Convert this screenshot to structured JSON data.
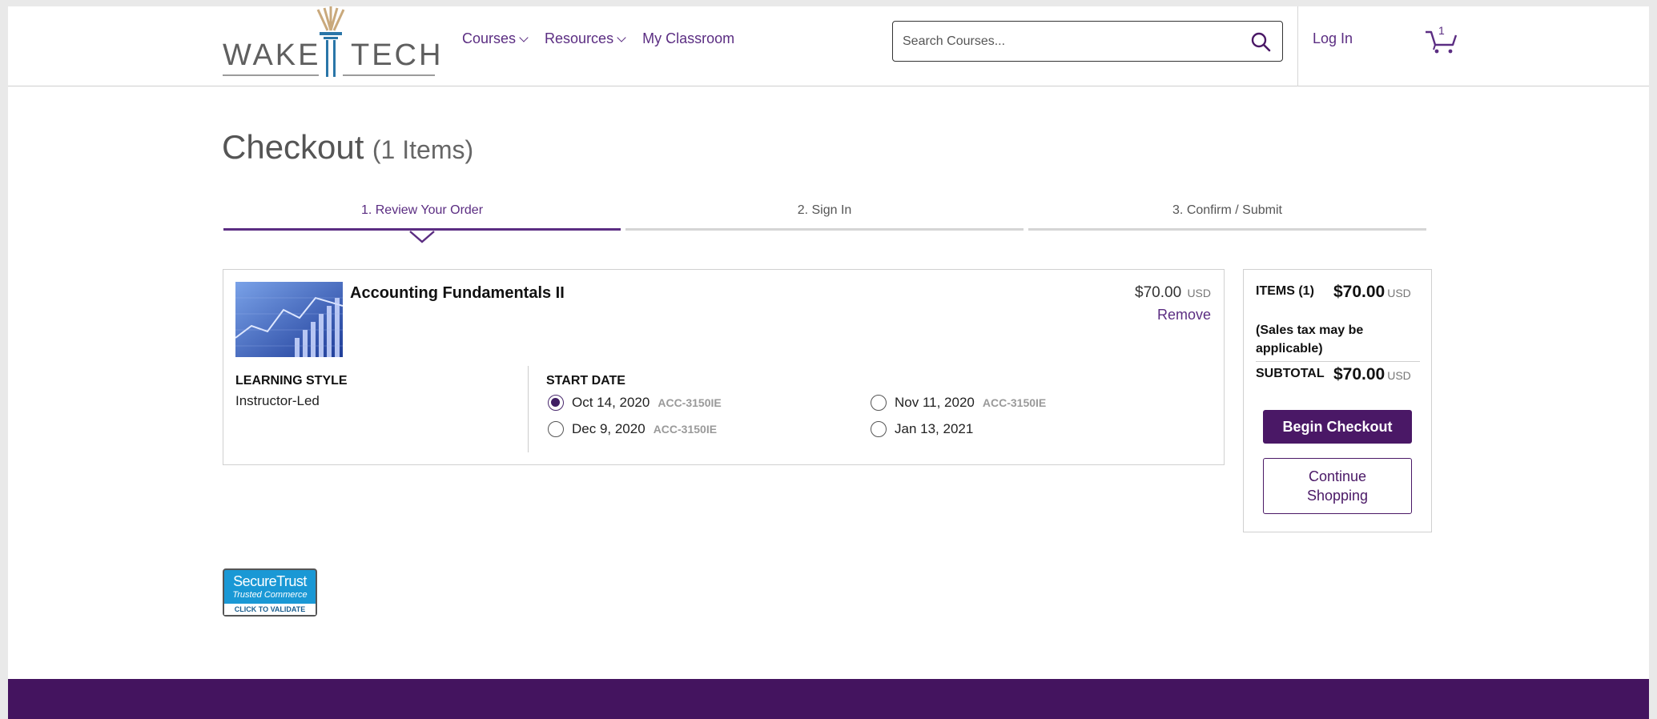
{
  "header": {
    "logo_left": "WAKE",
    "logo_right": "TECH",
    "nav": [
      {
        "label": "Courses",
        "dropdown": true
      },
      {
        "label": "Resources",
        "dropdown": true
      },
      {
        "label": "My Classroom",
        "dropdown": false
      }
    ],
    "search_placeholder": "Search Courses...",
    "login_label": "Log In",
    "cart_count": "1"
  },
  "page": {
    "title": "Checkout",
    "items_count": "(1 Items)"
  },
  "steps": [
    {
      "label": "1. Review Your Order",
      "active": true
    },
    {
      "label": "2. Sign In",
      "active": false
    },
    {
      "label": "3. Confirm / Submit",
      "active": false
    }
  ],
  "order": {
    "course_name": "Accounting Fundamentals II",
    "price": "$70.00",
    "currency": "USD",
    "remove_label": "Remove",
    "learning_style_label": "LEARNING STYLE",
    "learning_style_value": "Instructor-Led",
    "start_date_label": "START DATE",
    "dates": [
      {
        "date": "Oct 14, 2020",
        "code": "ACC-3150IE",
        "selected": true
      },
      {
        "date": "Nov 11, 2020",
        "code": "ACC-3150IE",
        "selected": false
      },
      {
        "date": "Dec 9, 2020",
        "code": "ACC-3150IE",
        "selected": false
      },
      {
        "date": "Jan 13, 2021",
        "code": "",
        "selected": false
      }
    ]
  },
  "summary": {
    "items_label": "ITEMS (1)",
    "items_amount": "$70.00",
    "currency": "USD",
    "tax_note": "(Sales tax may be applicable)",
    "subtotal_label": "SUBTOTAL",
    "subtotal_amount": "$70.00",
    "begin_checkout": "Begin Checkout",
    "continue_shopping": "Continue Shopping"
  },
  "badge": {
    "line1": "SecureTrust",
    "line2": "Trusted Commerce",
    "line3": "CLICK TO VALIDATE"
  },
  "colors": {
    "brand_purple": "#4a1866",
    "link_purple": "#5b2d82",
    "footer": "#44145f",
    "badge_blue": "#1a98d5"
  }
}
